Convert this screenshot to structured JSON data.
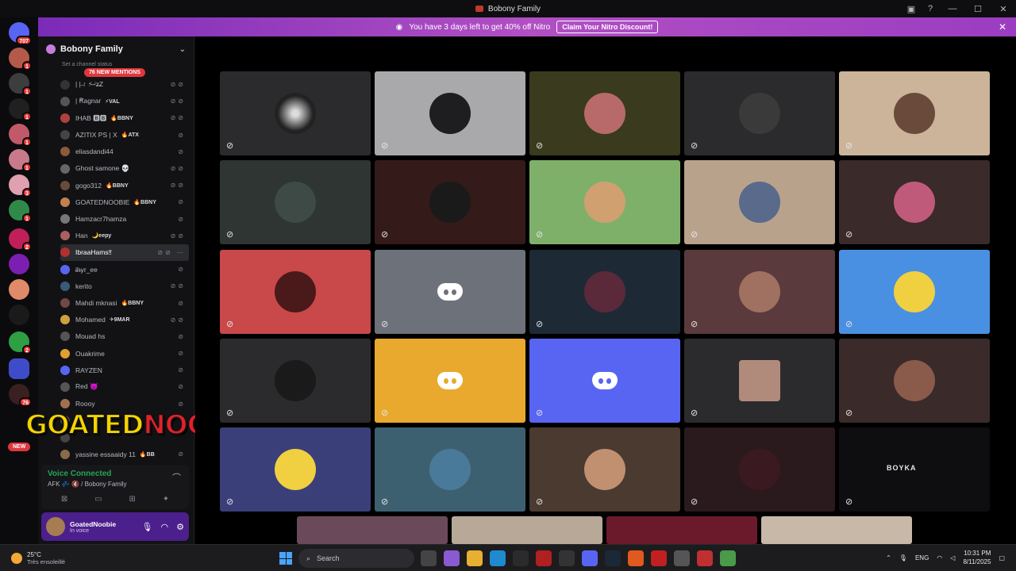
{
  "window": {
    "title": "Bobony Family"
  },
  "nitro": {
    "message": "You have 3 days left to get 40% off Nitro",
    "cta": "Claim Your Nitro Discount!",
    "close_icon": "close-icon"
  },
  "servers": {
    "home_badge": "707",
    "badges": [
      "1",
      "1",
      "1",
      "1",
      "1",
      "3",
      "1",
      "2",
      "2",
      "76",
      "NEW"
    ]
  },
  "guild": {
    "name": "Bobony Family",
    "status_placeholder": "Set a channel status",
    "mentions_pill": "76 NEW MENTIONS"
  },
  "members": [
    {
      "name": "| | ̶↑ ⚡ ⁱ̶z̶Z",
      "tag": ""
    },
    {
      "name": "| Ꞧagnar",
      "tag": "⚡VAL"
    },
    {
      "name": "IHAB 🅱🅱",
      "tag": "🔥BBNY"
    },
    {
      "name": "AZITIX PS | X",
      "tag": "🔥ATX"
    },
    {
      "name": "eliasdandi44",
      "tag": ""
    },
    {
      "name": "Ghost samone 💀",
      "tag": ""
    },
    {
      "name": "gogo312",
      "tag": "🔥BBNY"
    },
    {
      "name": "GOATEDNOOBIE",
      "tag": "🔥BBNY"
    },
    {
      "name": "Hamzacr7hamza",
      "tag": ""
    },
    {
      "name": "Han",
      "tag": "🌙eepy"
    },
    {
      "name": "IbraaHams‼",
      "tag": ""
    },
    {
      "name": "i̶h̶yr_ee",
      "tag": ""
    },
    {
      "name": "kerito",
      "tag": ""
    },
    {
      "name": "Mahdi mknasi",
      "tag": "🔥BBNY"
    },
    {
      "name": "Mohamed",
      "tag": "✈9MAR"
    },
    {
      "name": "Mouad hs",
      "tag": ""
    },
    {
      "name": "Ouakrime",
      "tag": ""
    },
    {
      "name": "RAYZEN",
      "tag": ""
    },
    {
      "name": "Red 👿",
      "tag": ""
    },
    {
      "name": "Roooy",
      "tag": ""
    },
    {
      "name": "",
      "tag": ""
    },
    {
      "name": "",
      "tag": ""
    },
    {
      "name": "yassine essaaidy 11",
      "tag": "🔥BB"
    }
  ],
  "voice": {
    "status": "Voice Connected",
    "channel": "AFK 💤 🔇 / Bobony Family"
  },
  "user": {
    "name": "GoatedNoobie",
    "status": "In voice"
  },
  "overlay": {
    "text_a": "GOATED",
    "text_b": "NOOBIE"
  },
  "tiles": {
    "boyka_label": "BOYKA"
  },
  "taskbar": {
    "temp": "25°C",
    "weather": "Très ensoleillé",
    "search_placeholder": "Search",
    "lang": "ENG",
    "time": "10:31 PM",
    "date": "8/11/2025"
  }
}
